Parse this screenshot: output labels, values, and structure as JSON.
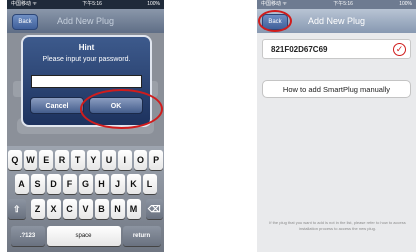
{
  "screen_left": {
    "status": {
      "carrier": "中国移动 ᯤ",
      "time": "下午5:16",
      "battery": "100%"
    },
    "nav": {
      "back": "Back",
      "title": "Add New Plug"
    },
    "alert": {
      "title": "Hint",
      "message": "Please input your password.",
      "input_value": "",
      "cancel_label": "Cancel",
      "ok_label": "OK"
    },
    "keyboard": {
      "row1": [
        "Q",
        "W",
        "E",
        "R",
        "T",
        "Y",
        "U",
        "I",
        "O",
        "P"
      ],
      "row2": [
        "A",
        "S",
        "D",
        "F",
        "G",
        "H",
        "J",
        "K",
        "L"
      ],
      "row3": [
        "Z",
        "X",
        "C",
        "V",
        "B",
        "N",
        "M"
      ],
      "shift": "⇧",
      "delete": "⌫",
      "numbers": ".?123",
      "space": "space",
      "return": "return"
    }
  },
  "screen_right": {
    "status": {
      "carrier": "中国移动 ᯤ",
      "time": "下午5:16",
      "battery": "100%"
    },
    "nav": {
      "back": "Back",
      "title": "Add New Plug"
    },
    "plug_code": "821F02D67C69",
    "check_icon": "✓",
    "how_to_label": "How to add SmartPlug manually",
    "footnote": "If the plug that you want to add is not in the list, please refer to how to access installation process to access the new plug."
  },
  "colors": {
    "highlight": "#d01c1c",
    "alert_bg": "#1d325e"
  }
}
